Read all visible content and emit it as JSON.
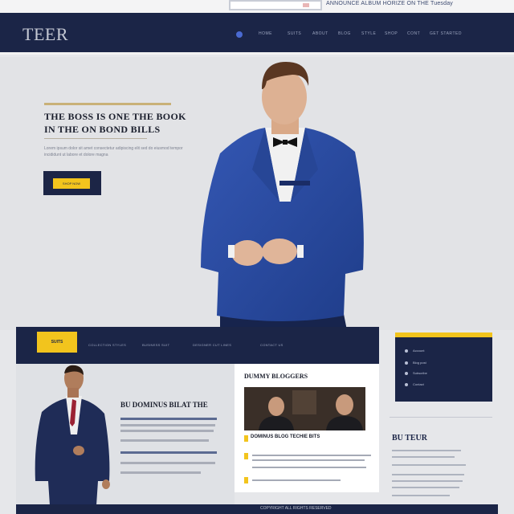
{
  "top_strip": {
    "text": "ANNOUNCE ALBUM HORIZE ON THE Tuesday"
  },
  "header": {
    "logo": "TEER",
    "nav": [
      "HOME",
      "SUITS",
      "ABOUT",
      "BLOG",
      "STYLE",
      "SHOP",
      "CONT",
      "GET STARTED"
    ]
  },
  "hero": {
    "title": "THE BOSS IS ONE THE BOOK IN THE ON BOND BILLS",
    "text": "Lorem ipsum dolor sit amet consectetur adipiscing elit sed do eiusmod tempor incididunt ut labore et dolore magna",
    "button_label": "SHOP NOW"
  },
  "band": {
    "tag": "SUITS",
    "items": [
      "COLLECTION STYLES",
      "BUSINESS SUIT",
      "DESIGNER CUT LINES",
      "CONTACT US"
    ]
  },
  "left_panel": {
    "title": "BU DOMINUS BILAT THE"
  },
  "mid_panel": {
    "title": "DUMMY BLOGGERS",
    "caption": "DOMINUS BLOG TECHIE BITS"
  },
  "side": {
    "items": [
      "Account",
      "Blog post",
      "Subscribe",
      "Contact"
    ],
    "title": "BU TEUR"
  },
  "bottom_bar": {
    "text": "COPYRIGHT ALL RIGHTS RESERVED"
  },
  "colors": {
    "navy": "#1b2547",
    "accent": "#f2c41d",
    "suit_blue": "#2c4ea3"
  }
}
